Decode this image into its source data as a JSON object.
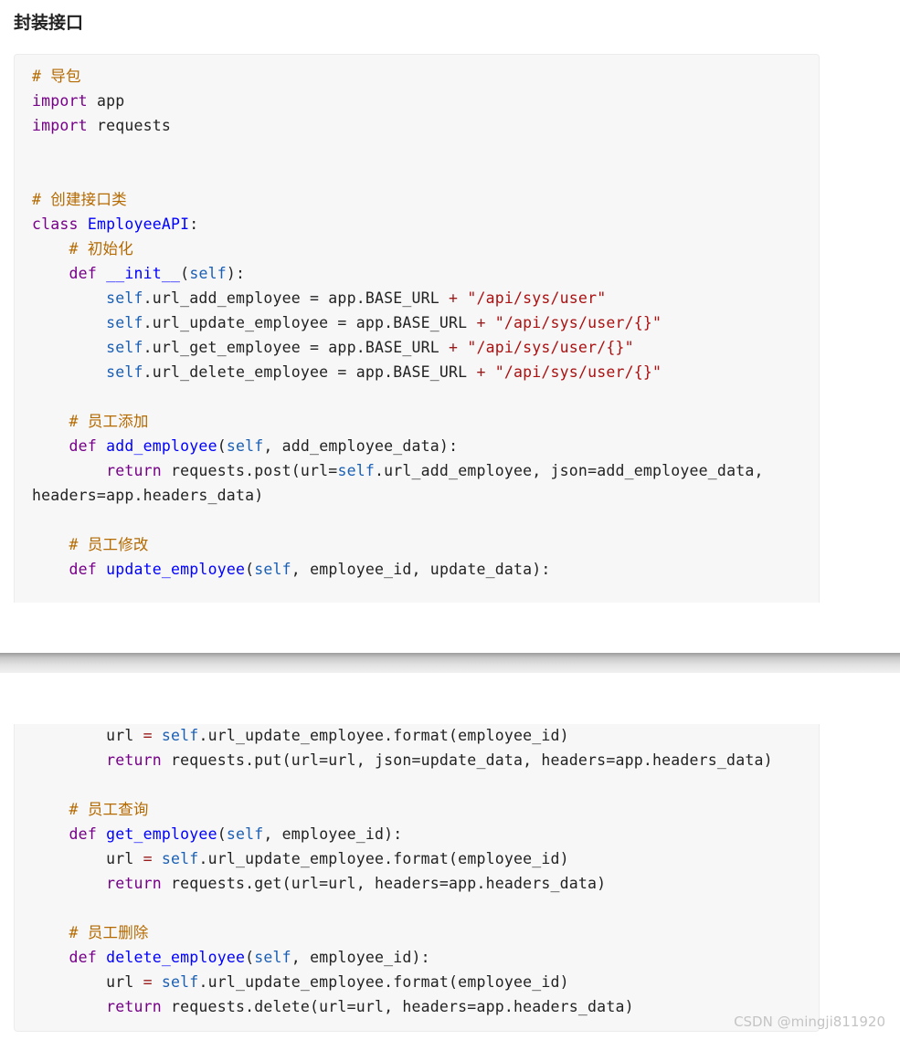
{
  "heading": "封装接口",
  "watermark": "CSDN @mingji811920",
  "code_part1": [
    [
      [
        "cm",
        "# 导包"
      ]
    ],
    [
      [
        "kw",
        "import"
      ],
      [
        "t",
        " app"
      ]
    ],
    [
      [
        "kw",
        "import"
      ],
      [
        "t",
        " requests"
      ]
    ],
    [],
    [],
    [
      [
        "cm",
        "# 创建接口类"
      ]
    ],
    [
      [
        "kw",
        "class"
      ],
      [
        "t",
        " "
      ],
      [
        "cls",
        "EmployeeAPI"
      ],
      [
        "t",
        ":"
      ]
    ],
    [
      [
        "t",
        "    "
      ],
      [
        "cm",
        "# 初始化"
      ]
    ],
    [
      [
        "t",
        "    "
      ],
      [
        "kw",
        "def"
      ],
      [
        "t",
        " "
      ],
      [
        "fn",
        "__init__"
      ],
      [
        "t",
        "("
      ],
      [
        "slf",
        "self"
      ],
      [
        "t",
        "):"
      ]
    ],
    [
      [
        "t",
        "        "
      ],
      [
        "slf",
        "self"
      ],
      [
        "t",
        ".url_add_employee = app.BASE_URL "
      ],
      [
        "op",
        "+"
      ],
      [
        "t",
        " "
      ],
      [
        "str",
        "\"/api/sys/user\""
      ]
    ],
    [
      [
        "t",
        "        "
      ],
      [
        "slf",
        "self"
      ],
      [
        "t",
        ".url_update_employee = app.BASE_URL "
      ],
      [
        "op",
        "+"
      ],
      [
        "t",
        " "
      ],
      [
        "str",
        "\"/api/sys/user/{}\""
      ]
    ],
    [
      [
        "t",
        "        "
      ],
      [
        "slf",
        "self"
      ],
      [
        "t",
        ".url_get_employee = app.BASE_URL "
      ],
      [
        "op",
        "+"
      ],
      [
        "t",
        " "
      ],
      [
        "str",
        "\"/api/sys/user/{}\""
      ]
    ],
    [
      [
        "t",
        "        "
      ],
      [
        "slf",
        "self"
      ],
      [
        "t",
        ".url_delete_employee = app.BASE_URL "
      ],
      [
        "op",
        "+"
      ],
      [
        "t",
        " "
      ],
      [
        "str",
        "\"/api/sys/user/{}\""
      ]
    ],
    [],
    [
      [
        "t",
        "    "
      ],
      [
        "cm",
        "# 员工添加"
      ]
    ],
    [
      [
        "t",
        "    "
      ],
      [
        "kw",
        "def"
      ],
      [
        "t",
        " "
      ],
      [
        "fn",
        "add_employee"
      ],
      [
        "t",
        "("
      ],
      [
        "slf",
        "self"
      ],
      [
        "t",
        ", add_employee_data):"
      ]
    ],
    [
      [
        "t",
        "        "
      ],
      [
        "kw",
        "return"
      ],
      [
        "t",
        " requests.post(url="
      ],
      [
        "slf",
        "self"
      ],
      [
        "t",
        ".url_add_employee, json=add_employee_data,"
      ]
    ],
    [
      [
        "t",
        "headers=app.headers_data)"
      ]
    ],
    [],
    [
      [
        "t",
        "    "
      ],
      [
        "cm",
        "# 员工修改"
      ]
    ],
    [
      [
        "t",
        "    "
      ],
      [
        "kw",
        "def"
      ],
      [
        "t",
        " "
      ],
      [
        "fn",
        "update_employee"
      ],
      [
        "t",
        "("
      ],
      [
        "slf",
        "self"
      ],
      [
        "t",
        ", employee_id, update_data):"
      ]
    ]
  ],
  "code_part2": [
    [
      [
        "t",
        "        url "
      ],
      [
        "op",
        "="
      ],
      [
        "t",
        " "
      ],
      [
        "slf",
        "self"
      ],
      [
        "t",
        ".url_update_employee.format(employee_id)"
      ]
    ],
    [
      [
        "t",
        "        "
      ],
      [
        "kw",
        "return"
      ],
      [
        "t",
        " requests.put(url=url, json=update_data, headers=app.headers_data)"
      ]
    ],
    [],
    [
      [
        "t",
        "    "
      ],
      [
        "cm",
        "# 员工查询"
      ]
    ],
    [
      [
        "t",
        "    "
      ],
      [
        "kw",
        "def"
      ],
      [
        "t",
        " "
      ],
      [
        "fn",
        "get_employee"
      ],
      [
        "t",
        "("
      ],
      [
        "slf",
        "self"
      ],
      [
        "t",
        ", employee_id):"
      ]
    ],
    [
      [
        "t",
        "        url "
      ],
      [
        "op",
        "="
      ],
      [
        "t",
        " "
      ],
      [
        "slf",
        "self"
      ],
      [
        "t",
        ".url_update_employee.format(employee_id)"
      ]
    ],
    [
      [
        "t",
        "        "
      ],
      [
        "kw",
        "return"
      ],
      [
        "t",
        " requests.get(url=url, headers=app.headers_data)"
      ]
    ],
    [],
    [
      [
        "t",
        "    "
      ],
      [
        "cm",
        "# 员工删除"
      ]
    ],
    [
      [
        "t",
        "    "
      ],
      [
        "kw",
        "def"
      ],
      [
        "t",
        " "
      ],
      [
        "fn",
        "delete_employee"
      ],
      [
        "t",
        "("
      ],
      [
        "slf",
        "self"
      ],
      [
        "t",
        ", employee_id):"
      ]
    ],
    [
      [
        "t",
        "        url "
      ],
      [
        "op",
        "="
      ],
      [
        "t",
        " "
      ],
      [
        "slf",
        "self"
      ],
      [
        "t",
        ".url_update_employee.format(employee_id)"
      ]
    ],
    [
      [
        "t",
        "        "
      ],
      [
        "kw",
        "return"
      ],
      [
        "t",
        " requests.delete(url=url, headers=app.headers_data)"
      ]
    ]
  ]
}
